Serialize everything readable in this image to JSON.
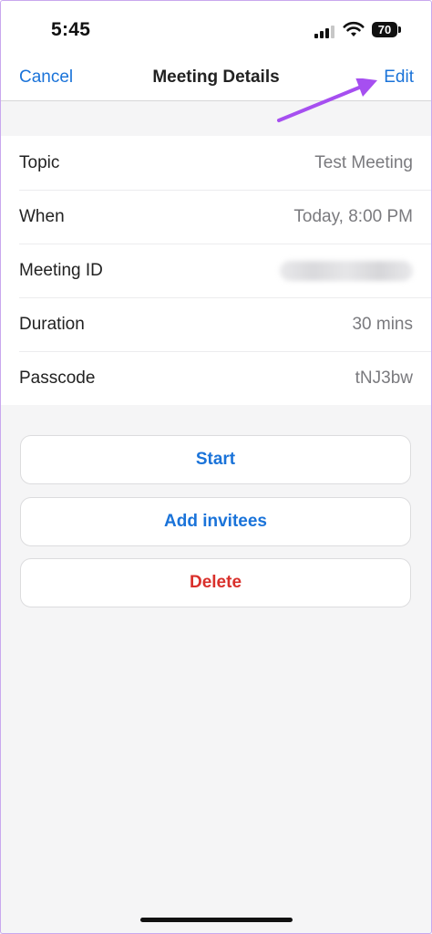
{
  "status_bar": {
    "time": "5:45",
    "battery": "70"
  },
  "nav": {
    "cancel_label": "Cancel",
    "title": "Meeting Details",
    "edit_label": "Edit"
  },
  "details": [
    {
      "label": "Topic",
      "value": "Test Meeting"
    },
    {
      "label": "When",
      "value": "Today, 8:00 PM"
    },
    {
      "label": "Meeting ID",
      "value": ""
    },
    {
      "label": "Duration",
      "value": "30 mins"
    },
    {
      "label": "Passcode",
      "value": "tNJ3bw"
    }
  ],
  "actions": {
    "start_label": "Start",
    "add_invitees_label": "Add invitees",
    "delete_label": "Delete"
  },
  "colors": {
    "accent": "#1a73d9",
    "danger": "#d9302b",
    "annotation_arrow": "#a64ff0"
  }
}
